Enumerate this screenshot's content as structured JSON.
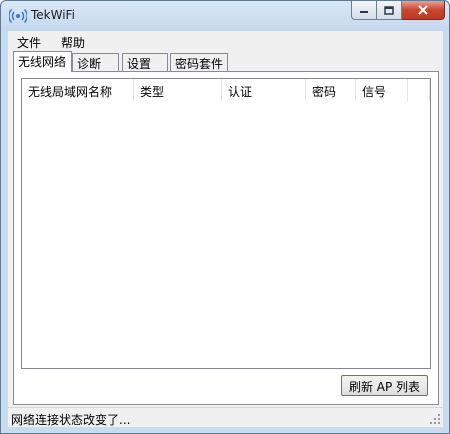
{
  "window": {
    "title": "TekWiFi"
  },
  "menu": {
    "file": "文件",
    "help": "帮助"
  },
  "tabs": [
    {
      "label": "无线网络"
    },
    {
      "label": "诊断"
    },
    {
      "label": "设置"
    },
    {
      "label": "密码套件"
    }
  ],
  "list": {
    "columns": [
      "无线局域网名称",
      "类型",
      "认证",
      "密码",
      "信号",
      ""
    ]
  },
  "buttons": {
    "refresh_label": "刷新 AP 列表"
  },
  "status": {
    "text": "网络连接状态改变了..."
  },
  "colors": {
    "title_gradient_top": "#dbe8f6",
    "close_button": "#c8452f",
    "panel_border": "#898c95"
  }
}
